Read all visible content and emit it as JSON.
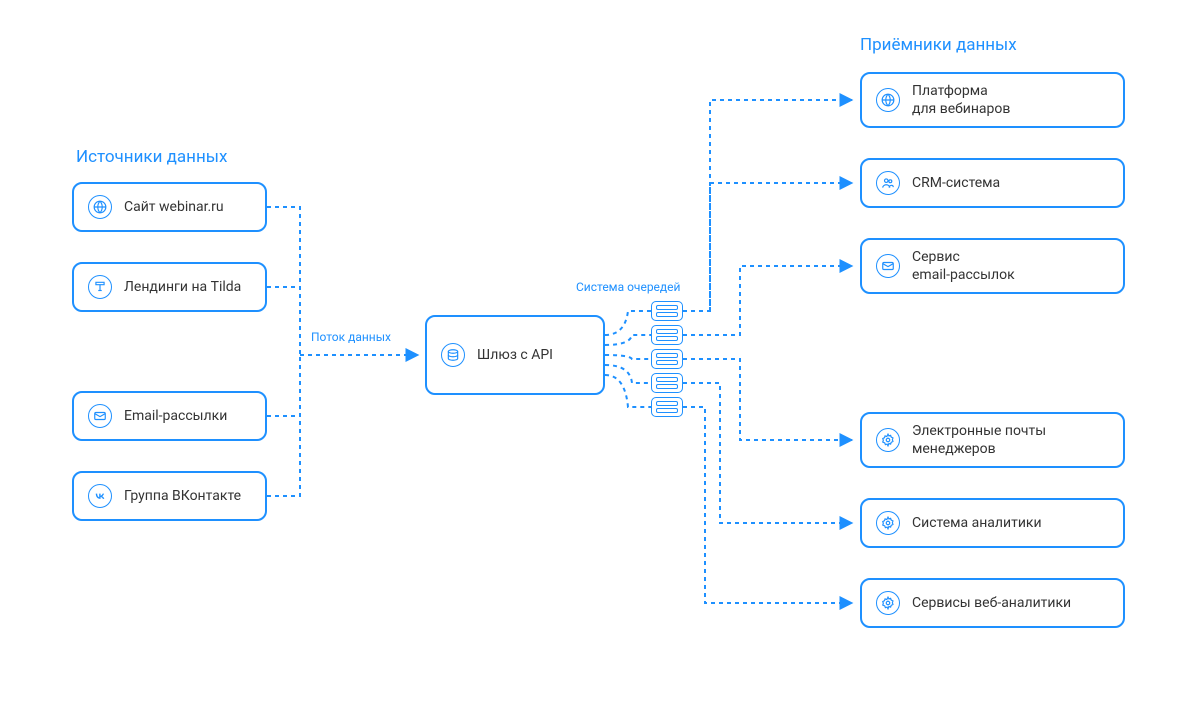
{
  "sections": {
    "sources_title": "Источники данных",
    "destinations_title": "Приёмники данных"
  },
  "sources": [
    {
      "label": "Сайт webinar.ru",
      "icon": "globe"
    },
    {
      "label": "Лендинги на Tilda",
      "icon": "tilda"
    },
    {
      "label": "Email-рассылки",
      "icon": "envelope"
    },
    {
      "label": "Группа ВКонтакте",
      "icon": "vk"
    }
  ],
  "gateway": {
    "label": "Шлюз с API",
    "icon": "database"
  },
  "destinations": [
    {
      "label": "Платформа\nдля вебинаров",
      "icon": "globe"
    },
    {
      "label": "CRM-система",
      "icon": "users"
    },
    {
      "label": "Сервис\nemail-рассылок",
      "icon": "envelope"
    },
    {
      "label": "Электронные почты\nменеджеров",
      "icon": "gear"
    },
    {
      "label": "Система аналитики",
      "icon": "gear"
    },
    {
      "label": "Сервисы веб-аналитики",
      "icon": "gear"
    }
  ],
  "annotations": {
    "flow": "Поток данных",
    "queue": "Система очередей"
  },
  "colors": {
    "primary": "#1E90FF",
    "text": "#333333",
    "bg": "#ffffff"
  }
}
